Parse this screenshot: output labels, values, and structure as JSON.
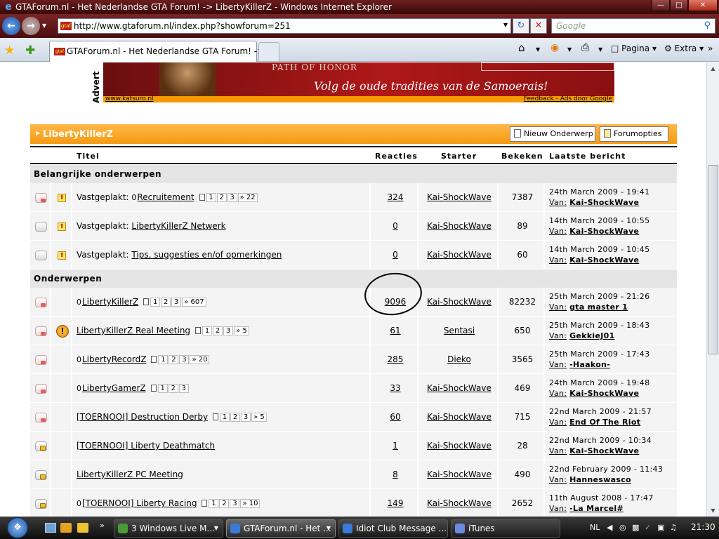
{
  "window": {
    "title": "GTAForum.nl - Het Nederlandse GTA Forum! -> LibertyKillerZ - Windows Internet Explorer",
    "buttons": [
      "minimize",
      "maximize",
      "close"
    ]
  },
  "addressbar": {
    "url": "http://www.gtaforum.nl/index.php?showforum=251",
    "favicon_text": "gtaf",
    "search_placeholder": "Google"
  },
  "tabs": {
    "active_label": "GTAForum.nl - Het Nederlandse GTA Forum! -> ...",
    "favicon_text": "gtaf"
  },
  "commandbar": {
    "page_label": "Pagina",
    "extra_label": "Extra"
  },
  "ad": {
    "side_label": "Advert",
    "brand": "PATH OF HONOR",
    "slogan": "Volg de oude tradities van de Samoerais!",
    "left_link": "www.katsuro.nl",
    "right_link": "Feedback - Ads door Google"
  },
  "forum": {
    "name": "LibertyKillerZ",
    "new_topic_label": "Nieuw Onderwerp",
    "options_label": "Forumopties",
    "columns": {
      "title": "Titel",
      "replies": "Reacties",
      "starter": "Starter",
      "views": "Bekeken",
      "last": "Laatste bericht"
    },
    "section_pinned": "Belangrijke onderwerpen",
    "section_topics": "Onderwerpen",
    "by_label": "Van:",
    "pinned_prefix": "Vastgeplakt:",
    "pinned": [
      {
        "title": "Recruitement",
        "pages": [
          "1",
          "2",
          "3",
          "» 22"
        ],
        "replies": "324",
        "starter": "Kai-ShockWave",
        "views": "7387",
        "last_date": "24th March 2009 - 19:41",
        "last_by": "Kai-ShockWave"
      },
      {
        "title": "LibertyKillerZ Netwerk",
        "pages": [],
        "replies": "0",
        "starter": "Kai-ShockWave",
        "views": "89",
        "last_date": "14th March 2009 - 10:55",
        "last_by": "Kai-ShockWave"
      },
      {
        "title": "Tips, suggesties en/of opmerkingen",
        "pages": [],
        "replies": "0",
        "starter": "Kai-ShockWave",
        "views": "60",
        "last_date": "14th March 2009 - 10:45",
        "last_by": "Kai-ShockWave"
      }
    ],
    "topics": [
      {
        "title": "LibertyKillerZ",
        "pages": [
          "1",
          "2",
          "3",
          "» 607"
        ],
        "replies": "9096",
        "starter": "Kai-ShockWave",
        "views": "82232",
        "last_date": "25th March 2009 - 21:26",
        "last_by": "gta master 1"
      },
      {
        "title": "LibertyKillerZ Real Meeting",
        "pages": [
          "1",
          "2",
          "3",
          "» 5"
        ],
        "replies": "61",
        "starter": "Sentasi",
        "views": "650",
        "last_date": "25th March 2009 - 18:43",
        "last_by": "GekkieJ01"
      },
      {
        "title": "LibertyRecordZ",
        "pages": [
          "1",
          "2",
          "3",
          "» 20"
        ],
        "replies": "285",
        "starter": "Dieko",
        "views": "3565",
        "last_date": "25th March 2009 - 17:43",
        "last_by": "-Haakon-"
      },
      {
        "title": "LibertyGamerZ",
        "pages": [
          "1",
          "2",
          "3"
        ],
        "replies": "33",
        "starter": "Kai-ShockWave",
        "views": "469",
        "last_date": "24th March 2009 - 19:48",
        "last_by": "Kai-ShockWave"
      },
      {
        "title": "[TOERNOOI] Destruction Derby",
        "pages": [
          "1",
          "2",
          "3",
          "» 5"
        ],
        "replies": "60",
        "starter": "Kai-ShockWave",
        "views": "715",
        "last_date": "22nd March 2009 - 21:57",
        "last_by": "End Of The Riot"
      },
      {
        "title": "[TOERNOOI] Liberty Deathmatch",
        "pages": [],
        "replies": "1",
        "starter": "Kai-ShockWave",
        "views": "28",
        "last_date": "22nd March 2009 - 10:34",
        "last_by": "Kai-ShockWave"
      },
      {
        "title": "LibertyKillerZ PC Meeting",
        "pages": [],
        "replies": "8",
        "starter": "Kai-ShockWave",
        "views": "490",
        "last_date": "22nd February 2009 - 11:43",
        "last_by": "Hanneswasco"
      },
      {
        "title": "[TOERNOOI] Liberty Racing",
        "pages": [
          "1",
          "2",
          "3",
          "» 10"
        ],
        "replies": "149",
        "starter": "Kai-ShockWave",
        "views": "2652",
        "last_date": "11th August 2008 - 17:47",
        "last_by": "-La Marcel#"
      }
    ]
  },
  "taskbar": {
    "more_symbol": "»",
    "buttons": [
      {
        "label": "3 Windows Live M...",
        "color": "#4a9a3a"
      },
      {
        "label": "GTAForum.nl - Het ...",
        "color": "#3a7ad8"
      },
      {
        "label": "Idiot Club Message ...",
        "color": "#3a7ad8"
      },
      {
        "label": "iTunes",
        "color": "#6a8ae0"
      }
    ],
    "lang": "NL",
    "clock": "21:30"
  }
}
